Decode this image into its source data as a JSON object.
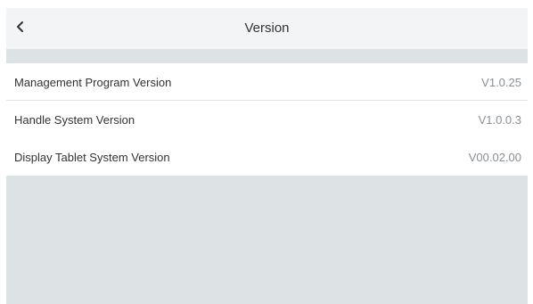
{
  "header": {
    "title": "Version",
    "back_icon": "chevron-left-icon"
  },
  "versions": [
    {
      "label": "Management Program Version",
      "value": "V1.0.25"
    },
    {
      "label": "Handle System Version",
      "value": "V1.0.0.3"
    },
    {
      "label": "Display Tablet System Version",
      "value": "V00.02.00"
    }
  ],
  "colors": {
    "background": "#dde2e5",
    "header": "#f3f4f5",
    "text": "#333333",
    "value_text": "#8a8f94"
  }
}
